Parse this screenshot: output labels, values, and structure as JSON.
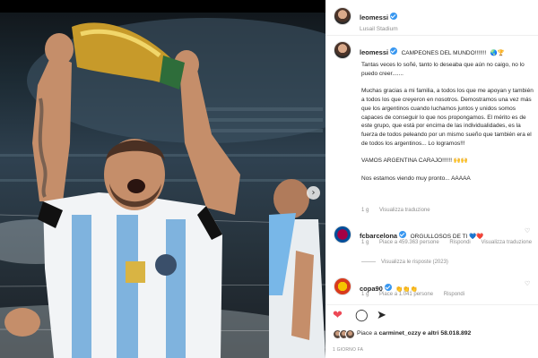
{
  "post": {
    "username": "leomessi",
    "location": "Lusail Stadium"
  },
  "caption": {
    "username": "leomessi",
    "headline": "CAMPEONES DEL MUNDO!!!!!!!",
    "headline_emoji": "🌏🏆",
    "body": "Tantas veces lo soñé, tanto lo deseaba que aún no caigo, no lo puedo creer.......\n\nMuchas gracias a mi familia, a todos los que me apoyan y también a todos los que creyeron en nosotros. Demostramos una vez más que los argentinos cuando luchamos juntos y unidos somos capaces de conseguir lo que nos propongamos. El mérito es de este grupo, que está por encima de las individualidades, es la fuerza de todos peleando por un mismo sueño que también era el de todos los argentinos... Lo logramos!!!\n\nVAMOS ARGENTINA CARAJO!!!!!! 🙌🙌\n\nNos estamos viendo muy pronto... AAAAA",
    "time": "1 g",
    "view_translation": "Visualizza traduzione"
  },
  "comments": [
    {
      "username": "fcbarcelona",
      "text": "ORGULLOSOS DE TI 💙❤️",
      "time": "1 g",
      "likes": "Piace a 459.363 persone",
      "reply": "Rispondi",
      "translate": "Visualizza traduzione",
      "view_replies": "Visualizza le risposte (2023)"
    },
    {
      "username": "copa90",
      "text": "👏👏👏",
      "time": "1 g",
      "likes": "Piace a 1.041 persone",
      "reply": "Rispondi"
    }
  ],
  "likes": {
    "prefix": "Piace a",
    "user": "carminet_ozzy",
    "suffix": "e altri 58.018.892"
  },
  "date": "1 GIORNO FA",
  "icons": {
    "like": "heart-icon",
    "comment": "comment-icon",
    "share": "share-icon",
    "next": "chevron-right-icon"
  },
  "colors": {
    "verified": "#3897f0",
    "like_red": "#ed4956",
    "text": "#262626",
    "muted": "#8e8e8e"
  }
}
